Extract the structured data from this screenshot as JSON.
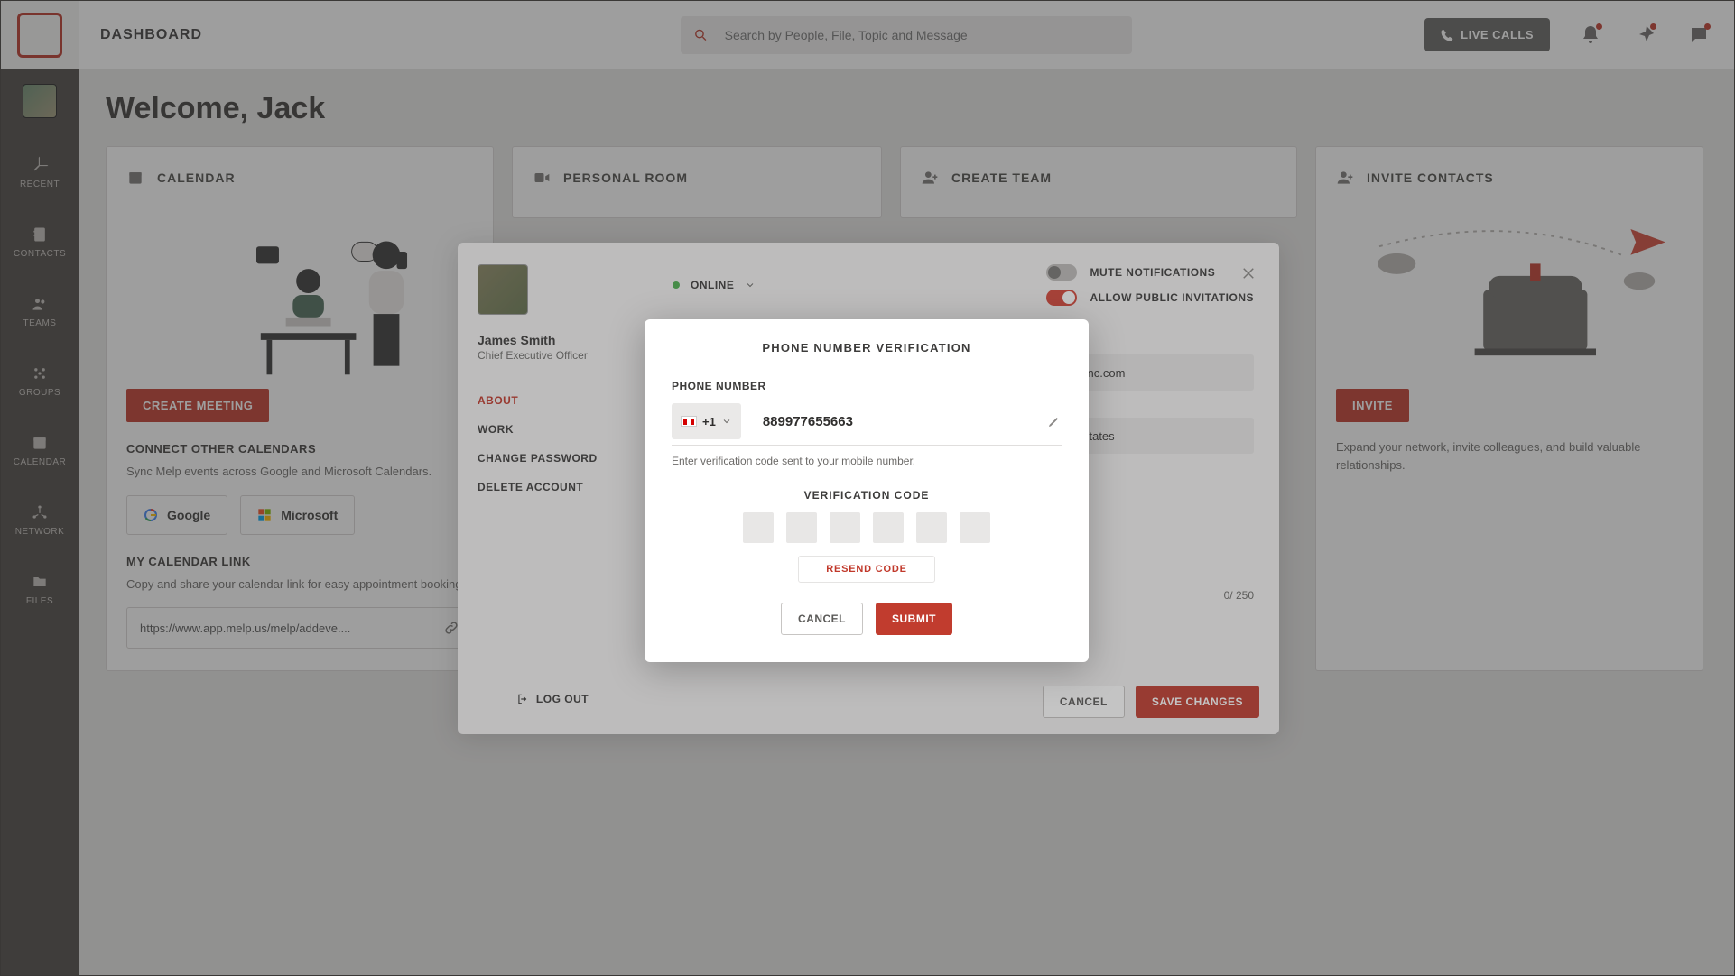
{
  "header": {
    "title": "DASHBOARD",
    "search_placeholder": "Search by People, File, Topic and Message",
    "live_calls": "LIVE CALLS"
  },
  "sidebar": {
    "items": [
      {
        "label": "RECENT"
      },
      {
        "label": "CONTACTS"
      },
      {
        "label": "TEAMS"
      },
      {
        "label": "GROUPS"
      },
      {
        "label": "CALENDAR"
      },
      {
        "label": "NETWORK"
      },
      {
        "label": "FILES"
      }
    ]
  },
  "welcome": "Welcome, Jack",
  "cards": {
    "calendar": {
      "title": "CALENDAR",
      "create_btn": "CREATE MEETING",
      "connect_title": "CONNECT OTHER CALENDARS",
      "connect_text": "Sync Melp events across Google and Microsoft Calendars.",
      "google": "Google",
      "microsoft": "Microsoft",
      "link_title": "MY CALENDAR LINK",
      "link_text": "Copy and share your calendar link for easy appointment booking.",
      "link_value": "https://www.app.melp.us/melp/addeve...."
    },
    "personal_room": {
      "title": "PERSONAL ROOM"
    },
    "create_team": {
      "title": "CREATE TEAM"
    },
    "invite_contacts": {
      "title": "INVITE CONTACTS",
      "btn": "INVITE",
      "text": "Expand your network, invite colleagues, and build valuable relationships."
    }
  },
  "profile": {
    "status": "ONLINE",
    "mute": "MUTE NOTIFICATIONS",
    "allow": "ALLOW PUBLIC INVITATIONS",
    "name": "James Smith",
    "role": "Chief Executive Officer",
    "menu": {
      "about": "ABOUT",
      "work": "WORK",
      "change": "CHANGE PASSWORD",
      "delete": "DELETE ACCOUNT"
    },
    "logout": "LOG OUT",
    "email_value": "@deepyinc.com",
    "location_value": ",United States",
    "char_count": "0/ 250",
    "cancel": "CANCEL",
    "save": "SAVE CHANGES"
  },
  "verify": {
    "title": "PHONE NUMBER VERIFICATION",
    "phone_label": "PHONE NUMBER",
    "country_code": "+1",
    "phone_value": "889977655663",
    "help": "Enter verification code sent to your mobile number.",
    "code_label": "VERIFICATION CODE",
    "resend": "RESEND CODE",
    "cancel": "CANCEL",
    "submit": "SUBMIT"
  }
}
